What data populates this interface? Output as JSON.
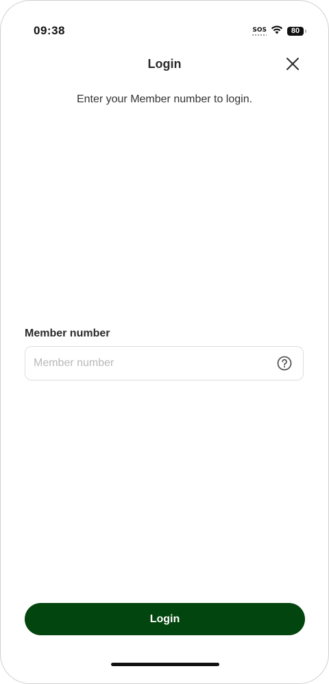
{
  "status_bar": {
    "time": "09:38",
    "sos": "SOS",
    "battery": "80"
  },
  "header": {
    "title": "Login"
  },
  "subtitle": "Enter your Member number to login.",
  "form": {
    "member_label": "Member number",
    "member_placeholder": "Member number",
    "member_value": ""
  },
  "actions": {
    "login_label": "Login"
  },
  "colors": {
    "primary": "#03450e"
  },
  "icons": {
    "close": "close-icon",
    "help": "help-circle-icon",
    "wifi": "wifi-icon",
    "battery": "battery-icon"
  }
}
